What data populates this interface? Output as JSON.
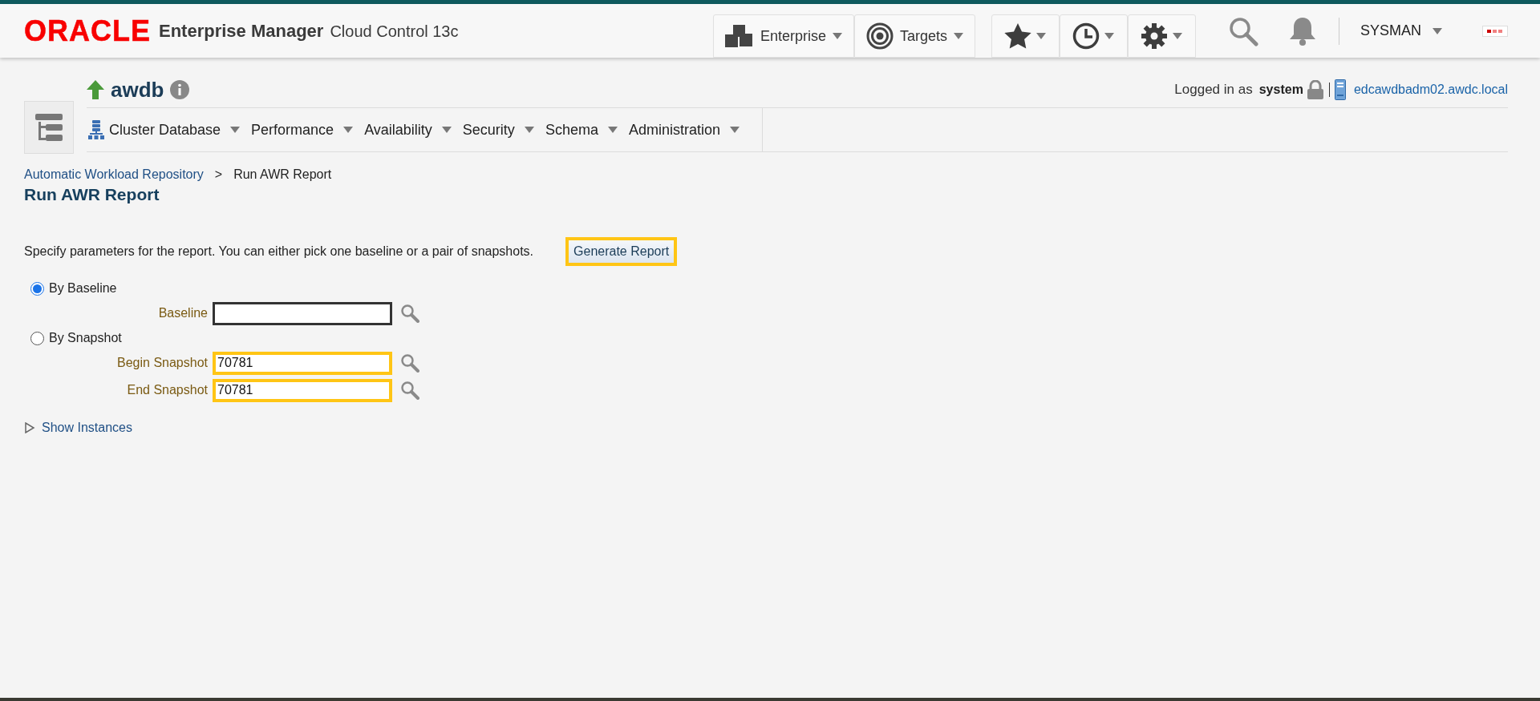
{
  "header": {
    "logo": "ORACLE",
    "product": "Enterprise Manager",
    "edition": "Cloud Control 13c",
    "menus": [
      {
        "kind": "enterprise",
        "label": "Enterprise"
      },
      {
        "kind": "targets",
        "label": "Targets"
      }
    ],
    "tools": [
      {
        "kind": "star"
      },
      {
        "kind": "clock"
      },
      {
        "kind": "gear"
      }
    ],
    "user": "SYSMAN"
  },
  "target": {
    "name": "awdb",
    "logged_in_label": "Logged in as",
    "user": "system",
    "host": "edcawdbadm02.awdc.local",
    "menu": [
      "Cluster Database",
      "Performance",
      "Availability",
      "Security",
      "Schema",
      "Administration"
    ]
  },
  "breadcrumb": [
    {
      "label": "Automatic Workload Repository",
      "kind": "link"
    },
    {
      "label": ">",
      "kind": "separator"
    },
    {
      "label": "Run AWR Report",
      "kind": "current"
    }
  ],
  "title": "Run AWR Report",
  "instructions": "Specify parameters for the report. You can either pick one baseline or a pair of snapshots.",
  "generate_button": {
    "label": "Generate Report",
    "highlighted": true
  },
  "options": [
    {
      "label": "By Baseline",
      "selected": true,
      "fields": [
        {
          "label": "Baseline",
          "highlighted": false,
          "focused": true
        }
      ]
    },
    {
      "label": "By Snapshot",
      "selected": false,
      "fields": [
        {
          "label": "Begin Snapshot",
          "value": "70781",
          "highlighted": true,
          "focused": false
        },
        {
          "label": "End Snapshot",
          "value": "70781",
          "highlighted": true,
          "focused": false
        }
      ]
    }
  ],
  "show_instances": {
    "label": "Show Instances",
    "expanded": false
  }
}
